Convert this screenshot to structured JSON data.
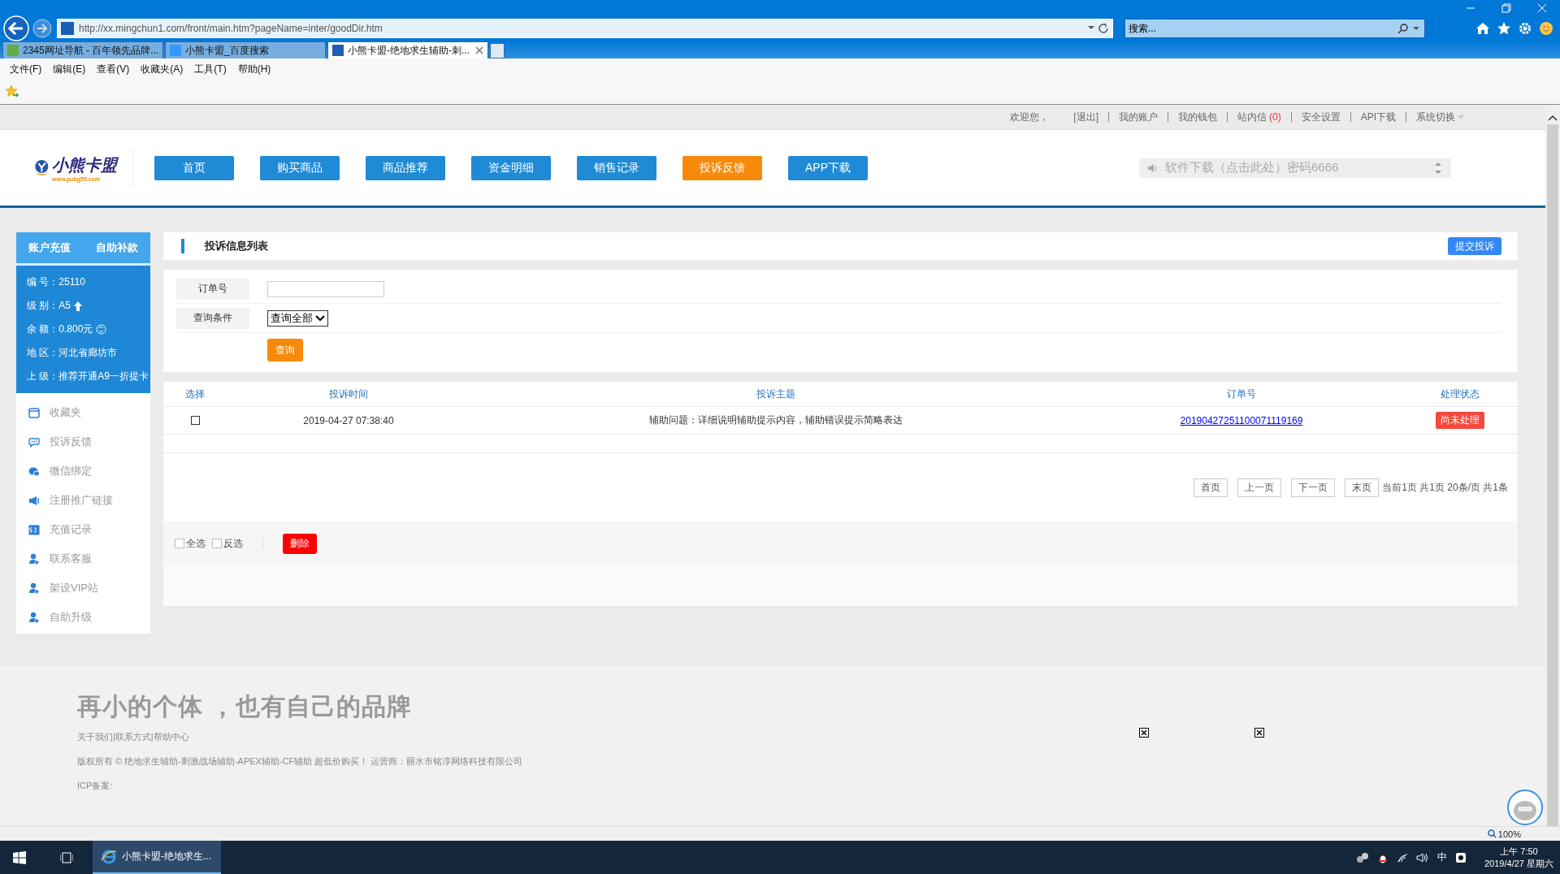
{
  "browser": {
    "url": "http://xx.mingchun1.com/front/main.htm?pageName=inter/goodDir.htm",
    "search_placeholder": "搜索...",
    "tabs": [
      {
        "label": "2345网址导航 - 百年领先品牌...",
        "selected": false
      },
      {
        "label": "小熊卡盟_百度搜索",
        "selected": false
      },
      {
        "label": "小熊卡盟-绝地求生辅助-刺...",
        "selected": true
      }
    ],
    "menu": [
      "文件(F)",
      "编辑(E)",
      "查看(V)",
      "收藏夹(A)",
      "工具(T)",
      "帮助(H)"
    ],
    "zoom": "100%"
  },
  "top_bar": {
    "welcome": "欢迎您，",
    "links": [
      {
        "label": "[退出]"
      },
      {
        "label": "我的账户"
      },
      {
        "label": "我的钱包"
      },
      {
        "label": "站内信",
        "count": "(0)"
      },
      {
        "label": "安全设置"
      },
      {
        "label": "API下载"
      },
      {
        "label": "系统切换"
      }
    ]
  },
  "header": {
    "logo_name": "小熊卡盟",
    "logo_url": "www.pubg55.com",
    "nav": [
      {
        "label": "首页",
        "selected": false
      },
      {
        "label": "购买商品",
        "selected": false
      },
      {
        "label": "商品推荐",
        "selected": false
      },
      {
        "label": "资金明细",
        "selected": false
      },
      {
        "label": "销售记录",
        "selected": false
      },
      {
        "label": "投诉反馈",
        "selected": true
      },
      {
        "label": "APP下载",
        "selected": false
      }
    ],
    "notice": "软件下载（点击此处）密码6666"
  },
  "sidebar": {
    "actions": [
      "账户充值",
      "自助补款"
    ],
    "info": [
      {
        "label": "编 号：",
        "value": "25110"
      },
      {
        "label": "级 别：",
        "value": "A5"
      },
      {
        "label": "余 额：",
        "value": "0.800元"
      },
      {
        "label": "地 区：",
        "value": "河北省廊坊市"
      },
      {
        "label": "上 级：",
        "value": "推荐开通A9一折提卡"
      }
    ],
    "items": [
      "收藏夹",
      "投诉反馈",
      "微信绑定",
      "注册推广链接",
      "充值记录",
      "联系客服",
      "架设VIP站",
      "自助升级"
    ]
  },
  "panel": {
    "title": "投诉信息列表",
    "submit": "提交投诉",
    "form": {
      "order_label": "订单号",
      "condition_label": "查询条件",
      "condition_value": "查询全部",
      "query": "查询"
    },
    "table": {
      "columns": [
        "选择",
        "投诉时间",
        "投诉主题",
        "订单号",
        "处理状态"
      ],
      "rows": [
        {
          "checked": false,
          "time": "2019-04-27 07:38:40",
          "subject": "辅助问题：详细说明辅助提示内容，辅助错误提示简略表达",
          "order": "20190427251100071119169",
          "status": "尚未处理"
        }
      ]
    },
    "pager": {
      "buttons": [
        "首页",
        "上一页",
        "下一页",
        "末页"
      ],
      "info": "当前1页 共1页 20条/页 共1条"
    },
    "bulk": {
      "select_all": {
        "label": "全选",
        "checked": false
      },
      "invert": {
        "label": "反选",
        "checked": false
      },
      "delete": "删除"
    }
  },
  "footer": {
    "slogan": "再小的个体 ，也有自己的品牌",
    "links": "关于我们|联系方式|帮助中心",
    "copyright": "版权所有 © 绝地求生辅助-刺激战场辅助-APEX辅助-CF辅助 超低价购买！ 运营商：丽水市铭淳网络科技有限公司",
    "icp": "ICP备案:"
  },
  "taskbar": {
    "app": "小熊卡盟-绝地求生...",
    "ime": "中",
    "time": "上午 7:50",
    "date": "2019/4/27 星期六"
  }
}
